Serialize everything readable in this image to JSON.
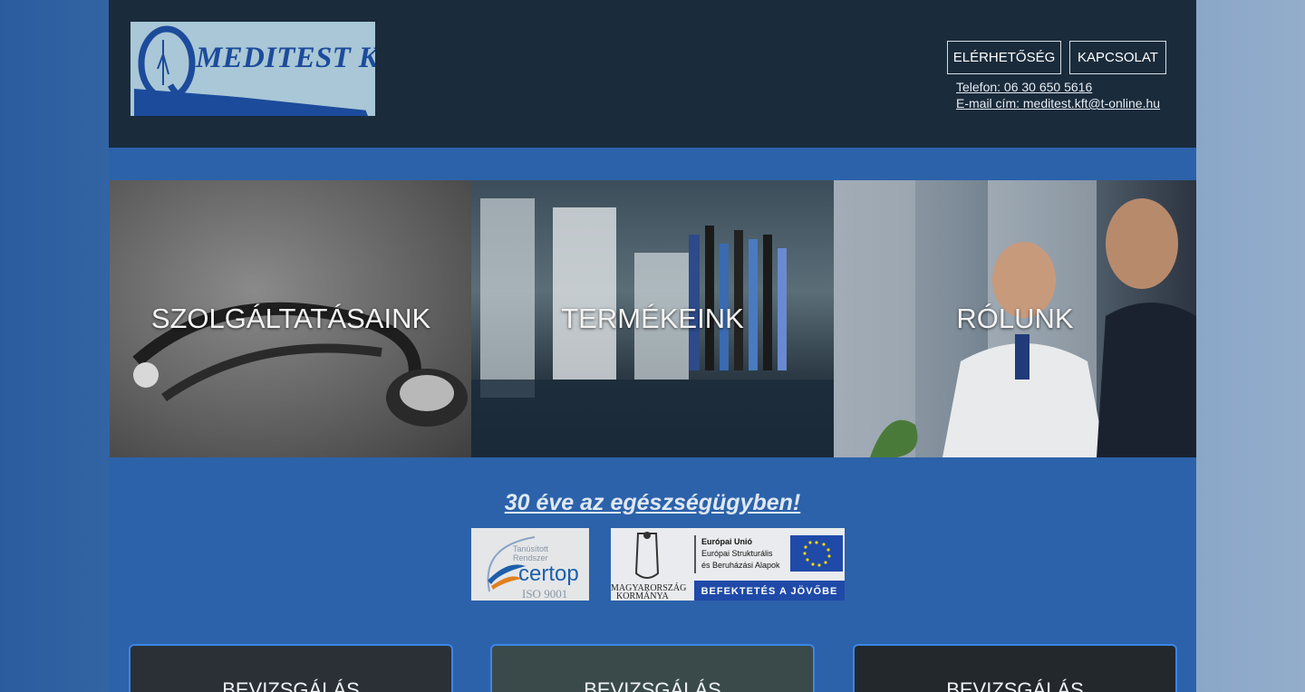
{
  "header": {
    "logo_text": "MEDITEST Kft.",
    "nav": [
      "ELÉRHETŐSÉG",
      "KAPCSOLAT"
    ],
    "phone": "Telefon: 06 30 650 5616",
    "email": "E-mail cím: meditest.kft@t-online.hu"
  },
  "tiles": [
    {
      "label": "SZOLGÁLTATÁSAINK"
    },
    {
      "label": "TERMÉKEINK"
    },
    {
      "label": "RÓLUNK"
    }
  ],
  "tagline": "30 éve az egészségügyben!",
  "cert": {
    "line1": "Tanúsított",
    "line2": "Rendszer",
    "brand": "certop",
    "standard": "ISO 9001"
  },
  "eu": {
    "gov_line1": "MAGYARORSZÁG",
    "gov_line2": "KORMÁNYA",
    "title": "Európai Unió",
    "line1": "Európai Strukturális",
    "line2": "és Beruházási Alapok",
    "banner": "BEFEKTETÉS A JÖVŐBE"
  },
  "cards": [
    {
      "label": "BEVIZSGÁLÁS"
    },
    {
      "label": "BEVIZSGÁLÁS"
    },
    {
      "label": "BEVIZSGÁLÁS"
    }
  ],
  "colors": {
    "header_bg": "#1a2b3b",
    "page_bg": "#2c62aa",
    "card_border": "#3a86e8"
  }
}
